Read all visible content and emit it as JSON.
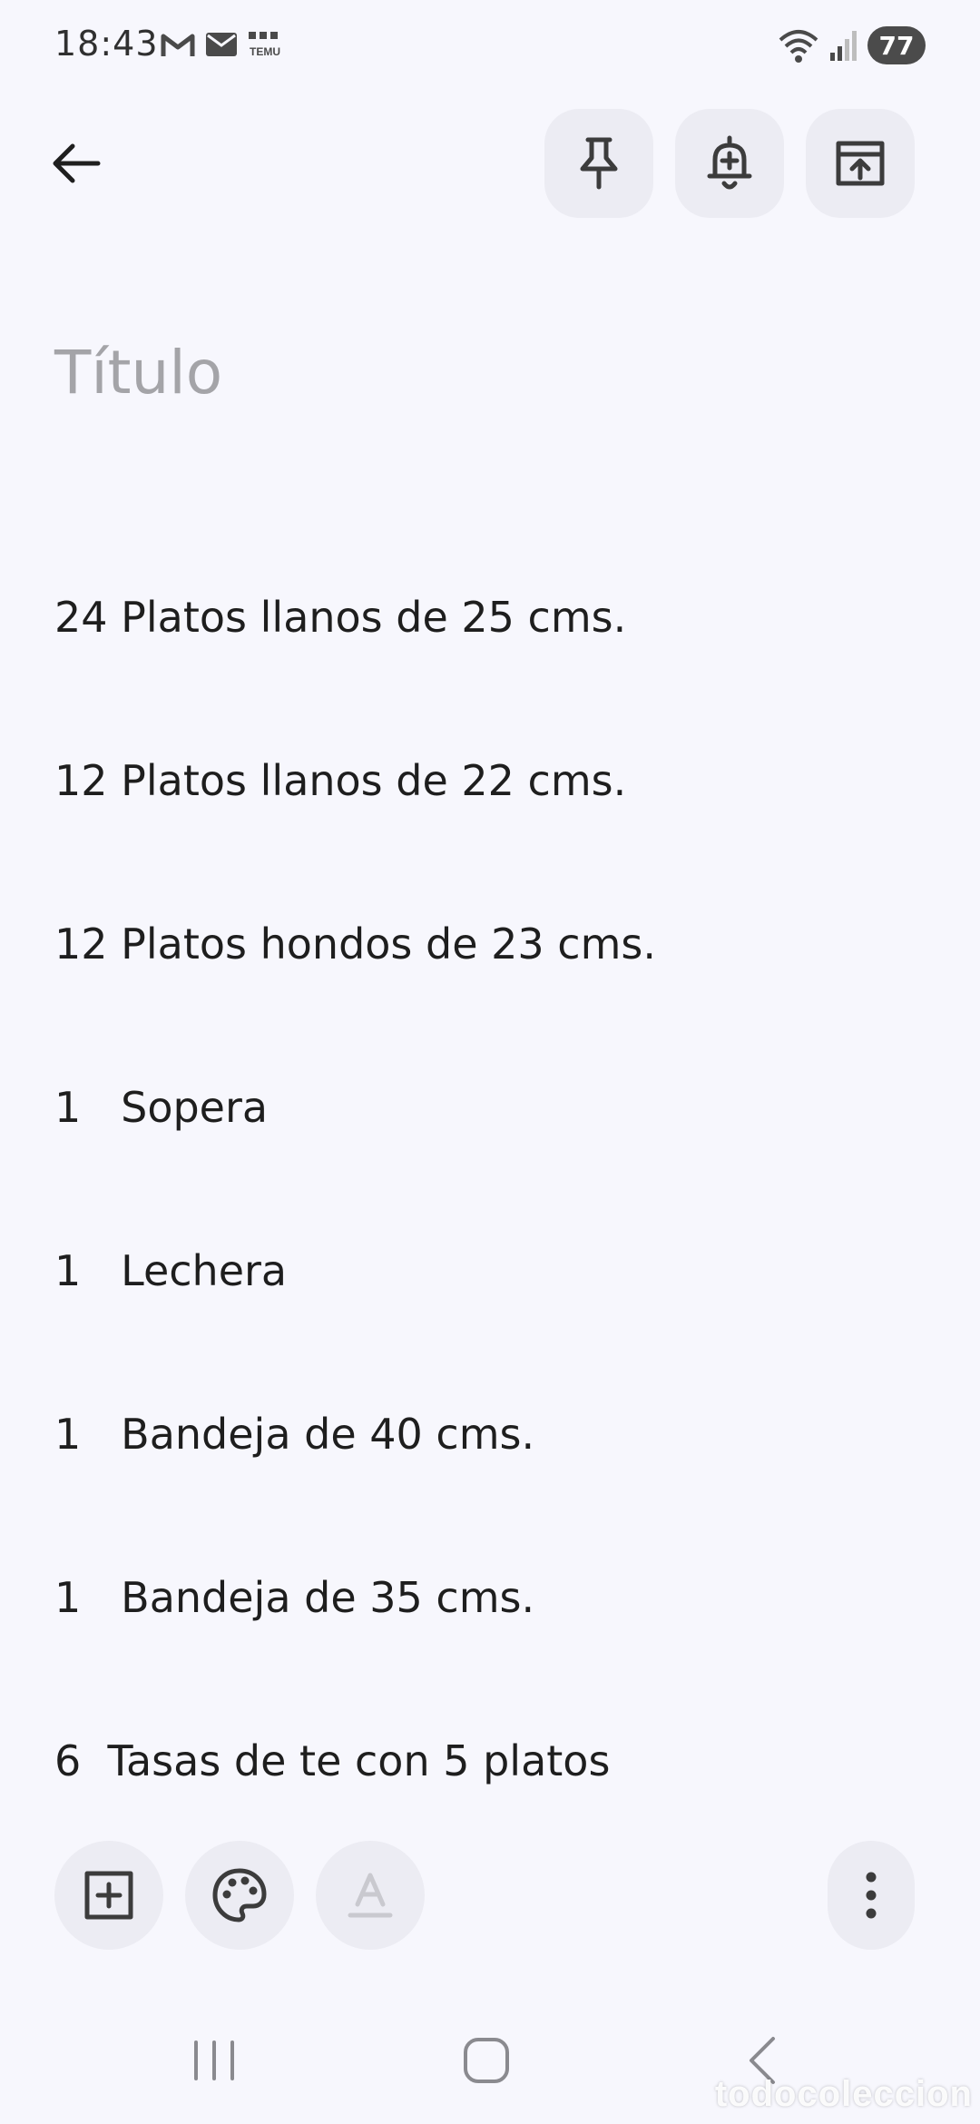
{
  "status_bar": {
    "time": "18:43",
    "notifications": [
      "gmail-icon",
      "mail-icon",
      "temu-icon"
    ],
    "temu_label": "TEMU",
    "battery": "77"
  },
  "toolbar": {
    "back": "back-arrow-icon",
    "pin": "pin-icon",
    "reminder": "bell-plus-icon",
    "archive": "archive-icon"
  },
  "note": {
    "title_placeholder": "Título",
    "lines": [
      "24 Platos llanos de 25 cms.",
      "12 Platos llanos de 22 cms.",
      "12 Platos hondos de 23 cms.",
      "1   Sopera",
      "1   Lechera",
      "1   Bandeja de 40 cms.",
      "1   Bandeja de 35 cms.",
      "6  Tasas de te con 5 platos"
    ]
  },
  "bottom_toolbar": {
    "add": "add-box-icon",
    "palette": "palette-icon",
    "text_format": "text-format-icon",
    "more": "more-vert-icon"
  },
  "navigation": {
    "recents": "recents-icon",
    "home": "home-icon",
    "back": "nav-back-icon"
  },
  "watermark": "todocoleccion",
  "colors": {
    "background": "#f7f7fd",
    "button_bg": "#ececf3",
    "title_placeholder": "#a4a4a8",
    "text": "#1e1e1e"
  }
}
